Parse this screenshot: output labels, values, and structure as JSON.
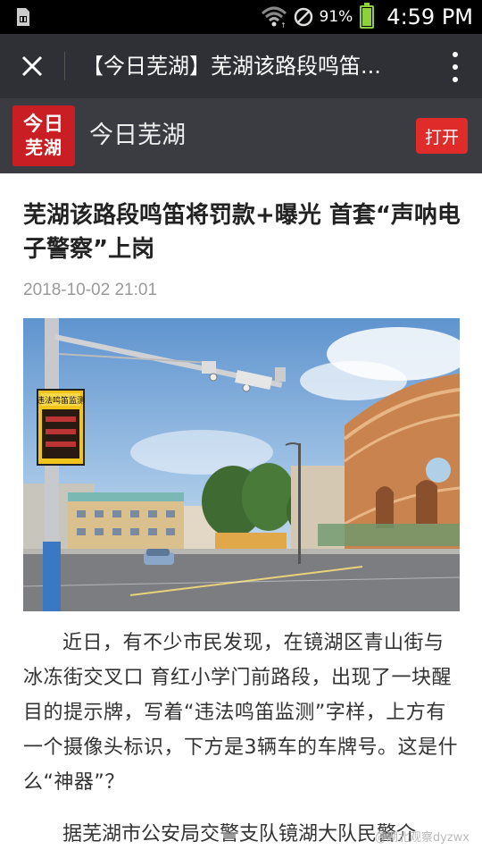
{
  "status_bar": {
    "battery_percent": "91%",
    "battery_level": 0.91,
    "time": "4:59 PM",
    "icons": [
      "sim-card-icon",
      "wifi-icon",
      "no-signal-icon",
      "battery-icon"
    ]
  },
  "nav": {
    "title": "【今日芜湖】芜湖该路段鸣笛...",
    "close_icon": "close-icon",
    "more_icon": "more-vertical-icon"
  },
  "account": {
    "logo_line1": "今日",
    "logo_line2": "芜湖",
    "name": "今日芜湖",
    "open_label": "打开",
    "brand_color": "#c91e23"
  },
  "article": {
    "title": "芜湖该路段鸣笛将罚款+曝光 首套“声呐电子警察”上岗",
    "date": "2018-10-02 21:01",
    "sign_text": "违法鸣笛监测",
    "paragraph1": "近日，有不少市民发现，在镜湖区青山街与冰冻街交叉口 育红小学门前路段，出现了一块醒目的提示牌，写着“违法鸣笛监测”字样，上方有一个摄像头标识，下方是3辆车的车牌号。这是什么“神器”？",
    "paragraph2": "据芜湖市公安局交警支队镜湖大队民警介",
    "watermark": "@湖北观察dyzwx"
  }
}
